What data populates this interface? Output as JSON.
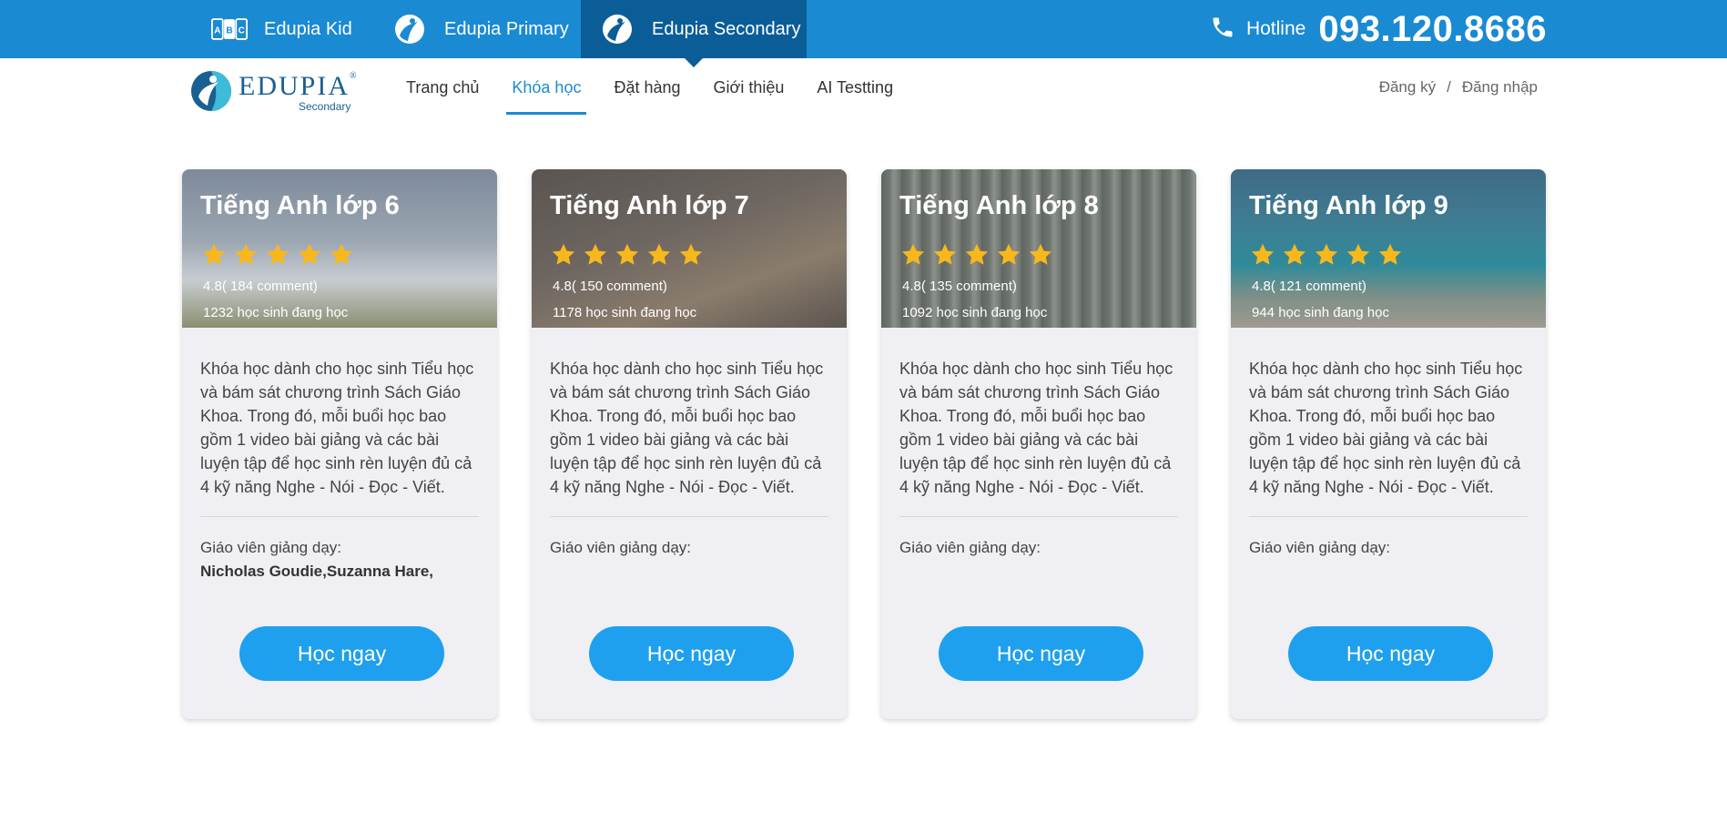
{
  "topbar": {
    "brands": [
      {
        "label": "Edupia Kid",
        "icon": "abc-blocks-icon"
      },
      {
        "label": "Edupia Primary",
        "icon": "edupia-mark-icon"
      },
      {
        "label": "Edupia Secondary",
        "icon": "edupia-mark-icon",
        "active": true
      }
    ],
    "hotline_label": "Hotline",
    "hotline_number": "093.120.8686"
  },
  "logo": {
    "word": "EDUPIA",
    "reg": "®",
    "sub": "Secondary"
  },
  "nav": {
    "items": [
      "Trang chủ",
      "Khóa học",
      "Đặt hàng",
      "Giới thiệu",
      "AI Testting"
    ],
    "active_index": 1
  },
  "auth": {
    "register": "Đăng ký",
    "separator": "/",
    "login": "Đăng nhập"
  },
  "colors": {
    "brand_blue": "#1a8ad3",
    "active_tab": "#0b5d98",
    "button_blue": "#1ea0ee",
    "star": "#f8b81b",
    "card_bg": "#efeff4"
  },
  "cards": [
    {
      "title": "Tiếng Anh lớp 6",
      "stars": 5,
      "rating": "4.8( 184 comment)",
      "students": "1232 học sinh đang học",
      "description": "Khóa học dành cho học sinh Tiểu học và bám sát chương trình Sách Giáo Khoa. Trong đó, mỗi buổi học bao gồm 1 video bài giảng và các bài luyện tập để học sinh rèn luyện đủ cả 4 kỹ năng Nghe - Nói - Đọc - Viết.",
      "teacher_label": "Giáo viên giảng dạy:",
      "teachers": "Nicholas Goudie,Suzanna Hare,",
      "button": "Học ngay"
    },
    {
      "title": "Tiếng Anh lớp 7",
      "stars": 5,
      "rating": "4.8( 150 comment)",
      "students": "1178 học sinh đang học",
      "description": "Khóa học dành cho học sinh Tiểu học và bám sát chương trình Sách Giáo Khoa. Trong đó, mỗi buổi học bao gồm 1 video bài giảng và các bài luyện tập để học sinh rèn luyện đủ cả 4 kỹ năng Nghe - Nói - Đọc - Viết.",
      "teacher_label": "Giáo viên giảng dạy:",
      "teachers": "",
      "button": "Học ngay"
    },
    {
      "title": "Tiếng Anh lớp 8",
      "stars": 5,
      "rating": "4.8( 135 comment)",
      "students": "1092 học sinh đang học",
      "description": "Khóa học dành cho học sinh Tiểu học và bám sát chương trình Sách Giáo Khoa. Trong đó, mỗi buổi học bao gồm 1 video bài giảng và các bài luyện tập để học sinh rèn luyện đủ cả 4 kỹ năng Nghe - Nói - Đọc - Viết.",
      "teacher_label": "Giáo viên giảng dạy:",
      "teachers": "",
      "button": "Học ngay"
    },
    {
      "title": "Tiếng Anh lớp 9",
      "stars": 5,
      "rating": "4.8( 121 comment)",
      "students": "944 học sinh đang học",
      "description": "Khóa học dành cho học sinh Tiểu học và bám sát chương trình Sách Giáo Khoa. Trong đó, mỗi buổi học bao gồm 1 video bài giảng và các bài luyện tập để học sinh rèn luyện đủ cả 4 kỹ năng Nghe - Nói - Đọc - Viết.",
      "teacher_label": "Giáo viên giảng dạy:",
      "teachers": "",
      "button": "Học ngay"
    }
  ]
}
